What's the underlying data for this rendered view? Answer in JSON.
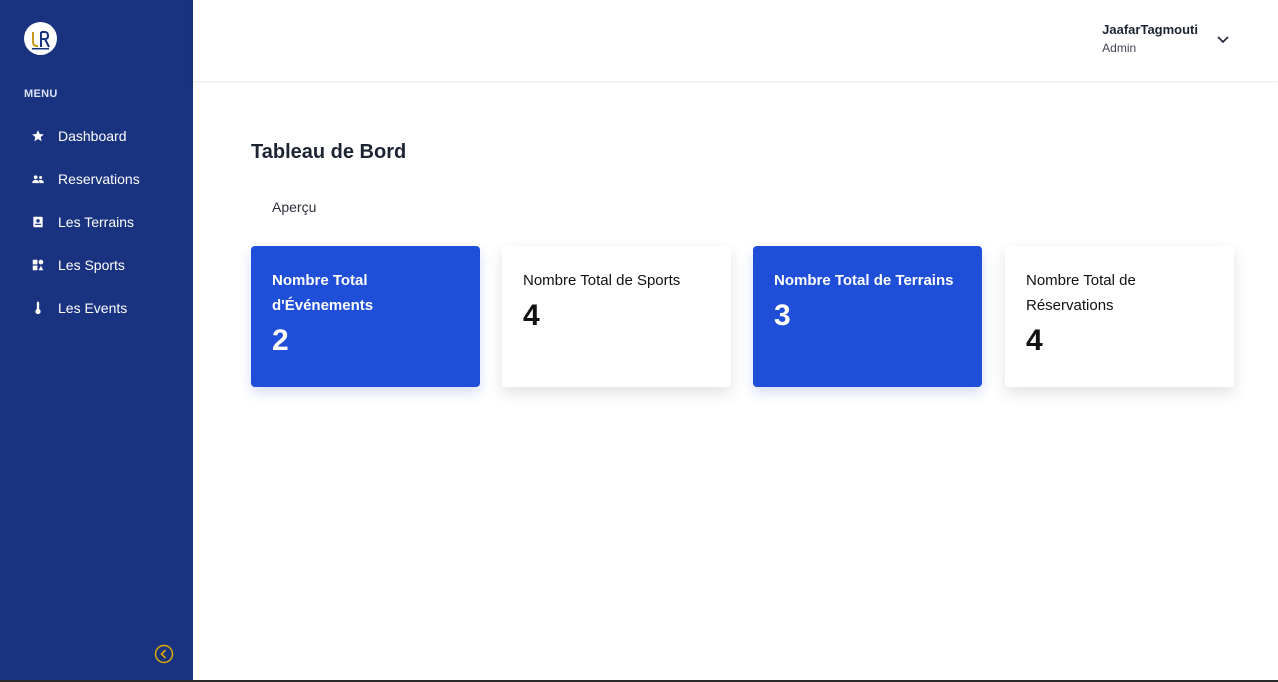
{
  "sidebar": {
    "menu_heading": "MENU",
    "items": [
      {
        "label": "Dashboard",
        "icon": "star-icon"
      },
      {
        "label": "Reservations",
        "icon": "users-icon"
      },
      {
        "label": "Les Terrains",
        "icon": "book-icon"
      },
      {
        "label": "Les Sports",
        "icon": "sports-icon"
      },
      {
        "label": "Les Events",
        "icon": "thermometer-icon"
      }
    ],
    "collapse_icon": "chevron-left-circle-icon",
    "bg_color": "#1a3380",
    "accent": "#e0a800"
  },
  "header": {
    "user_name": "JaafarTagmouti",
    "user_role": "Admin"
  },
  "main": {
    "title": "Tableau de Bord",
    "subtitle": "Aperçu",
    "cards": [
      {
        "label": "Nombre Total d'Événements",
        "value": "2",
        "style": "blue"
      },
      {
        "label": "Nombre Total de Sports",
        "value": "4",
        "style": "white"
      },
      {
        "label": "Nombre Total de Terrains",
        "value": "3",
        "style": "blue"
      },
      {
        "label": "Nombre Total de Réservations",
        "value": "4",
        "style": "white"
      }
    ],
    "card_blue": "#1f4fd8"
  }
}
